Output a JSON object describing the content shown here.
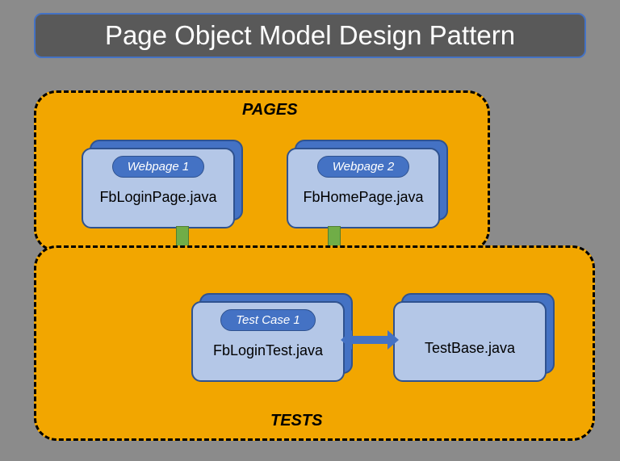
{
  "title": "Page Object Model Design Pattern",
  "groups": {
    "pages": {
      "label": "PAGES"
    },
    "tests": {
      "label": "TESTS"
    }
  },
  "cards": {
    "webpage1": {
      "pill": "Webpage 1",
      "text": "FbLoginPage.java"
    },
    "webpage2": {
      "pill": "Webpage 2",
      "text": "FbHomePage.java"
    },
    "testcase1": {
      "pill": "Test Case 1",
      "text": "FbLoginTest.java"
    },
    "testbase": {
      "text": "TestBase.java"
    }
  }
}
